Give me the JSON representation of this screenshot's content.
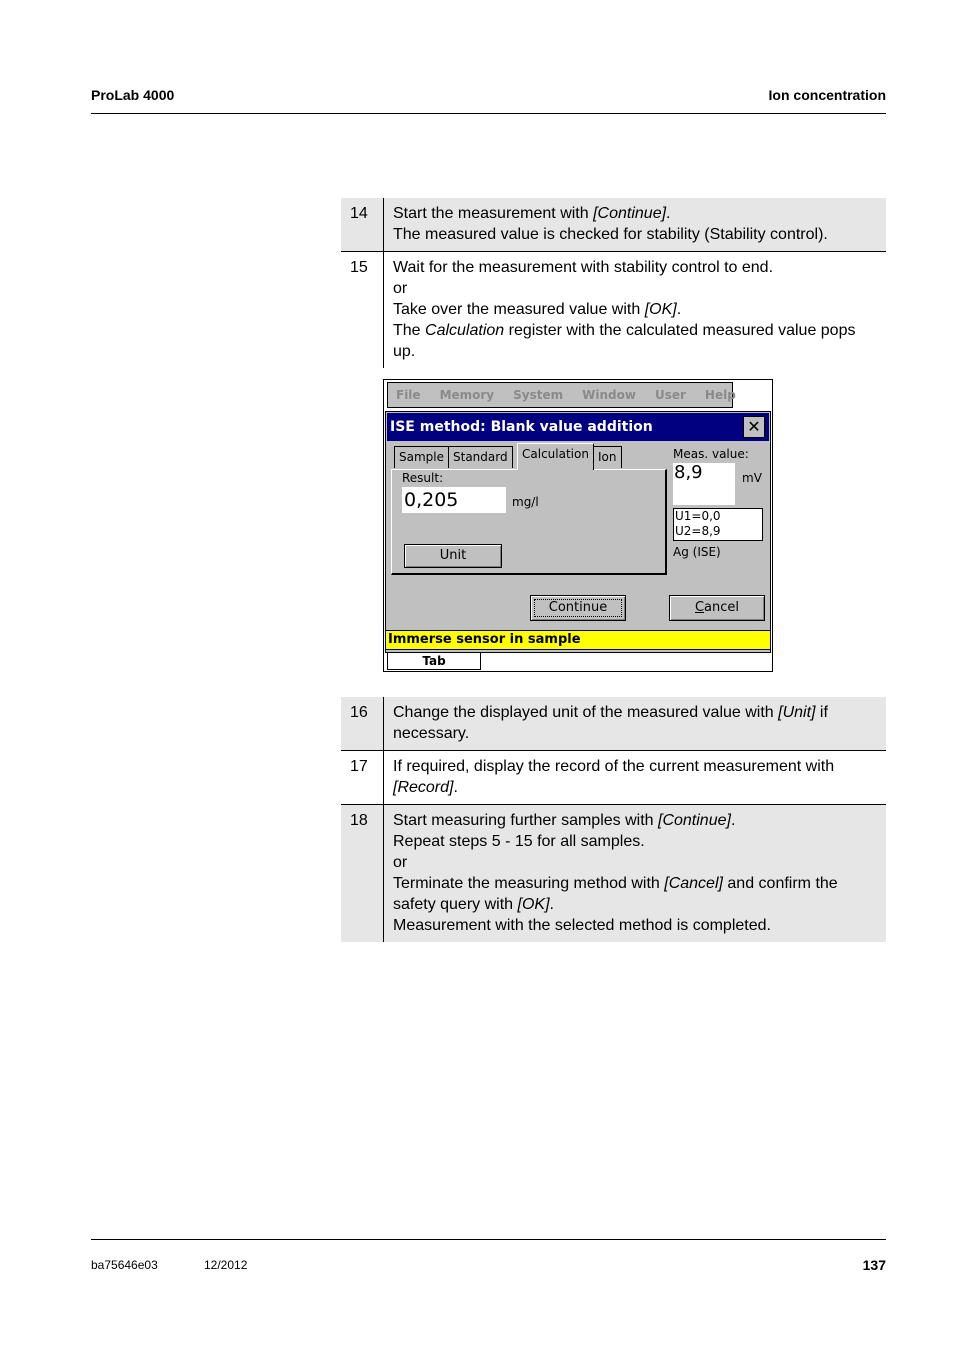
{
  "header": {
    "left": "ProLab 4000",
    "right": "Ion concentration"
  },
  "footer": {
    "doc_id": "ba75646e03",
    "date": "12/2012",
    "page": "137"
  },
  "steps_a": [
    {
      "num": "14",
      "lines": [
        [
          {
            "t": "Start the measurement with "
          },
          {
            "t": "[Continue]",
            "i": true
          },
          {
            "t": "."
          }
        ],
        [
          {
            "t": "The measured value is checked for stability (Stability control)."
          }
        ]
      ]
    },
    {
      "num": "15",
      "lines": [
        [
          {
            "t": "Wait for the measurement with stability control to end."
          }
        ],
        [
          {
            "t": "or"
          }
        ],
        [
          {
            "t": "Take over the measured value with "
          },
          {
            "t": "[OK]",
            "i": true
          },
          {
            "t": "."
          }
        ],
        [
          {
            "t": "The "
          },
          {
            "t": "Calculation",
            "i": true
          },
          {
            "t": " register with the calculated measured value pops up."
          }
        ]
      ]
    }
  ],
  "steps_b": [
    {
      "num": "16",
      "lines": [
        [
          {
            "t": "Change the displayed unit of the measured value with "
          },
          {
            "t": "[Unit]",
            "i": true
          },
          {
            "t": " if necessary."
          }
        ]
      ]
    },
    {
      "num": "17",
      "lines": [
        [
          {
            "t": "If required, display the record of the current measurement with "
          },
          {
            "t": "[Record]",
            "i": true
          },
          {
            "t": "."
          }
        ]
      ]
    },
    {
      "num": "18",
      "lines": [
        [
          {
            "t": "Start measuring further samples with "
          },
          {
            "t": "[Continue]",
            "i": true
          },
          {
            "t": "."
          }
        ],
        [
          {
            "t": "Repeat steps 5 - 15 for all samples."
          }
        ],
        [
          {
            "t": "or"
          }
        ],
        [
          {
            "t": "Terminate the measuring method with "
          },
          {
            "t": "[Cancel]",
            "i": true
          },
          {
            "t": " and confirm the safety query with "
          },
          {
            "t": "[OK]",
            "i": true
          },
          {
            "t": "."
          }
        ],
        [
          {
            "t": "Measurement with the selected method is completed."
          }
        ]
      ]
    }
  ],
  "device": {
    "menu": [
      "File",
      "Memory",
      "System",
      "Window",
      "User",
      "Help"
    ],
    "title": "ISE method:  Blank value addition",
    "close": "✕",
    "tabs": [
      "Sample",
      "Standard",
      "Calculation",
      "Ion"
    ],
    "active_tab": "Calculation",
    "result_label": "Result:",
    "result_value": "0,205",
    "result_unit": "mg/l",
    "unit_button": "Unit",
    "meas_label": "Meas. value:",
    "meas_value": "8,9",
    "meas_unit": "mV",
    "u1": "U1=0,0",
    "u2": "U2=8,9",
    "sensor": "Ag (ISE)",
    "continue_button": "Continue",
    "cancel_button": "Cancel",
    "status_text": "Immerse sensor in sample",
    "tab_key": "Tab"
  }
}
